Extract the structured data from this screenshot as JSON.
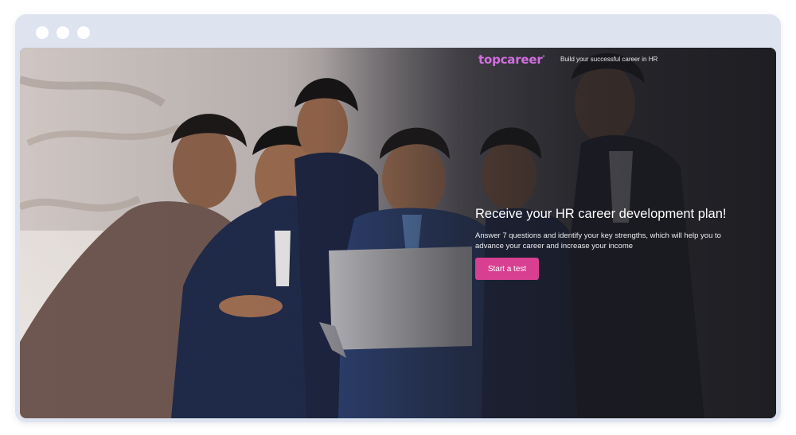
{
  "browser": {
    "window_controls": [
      "dot",
      "dot",
      "dot"
    ]
  },
  "header": {
    "logo": "topcareer",
    "logo_mark": "°",
    "tagline": "Build your successful career in HR"
  },
  "hero": {
    "title": "Receive your HR career development plan!",
    "description": "Answer 7 questions and identify your key strengths, which will help you to advance your career and increase your income",
    "cta_label": "Start a test",
    "cta_color": "#d93f91",
    "logo_color": "#d26fe0"
  }
}
